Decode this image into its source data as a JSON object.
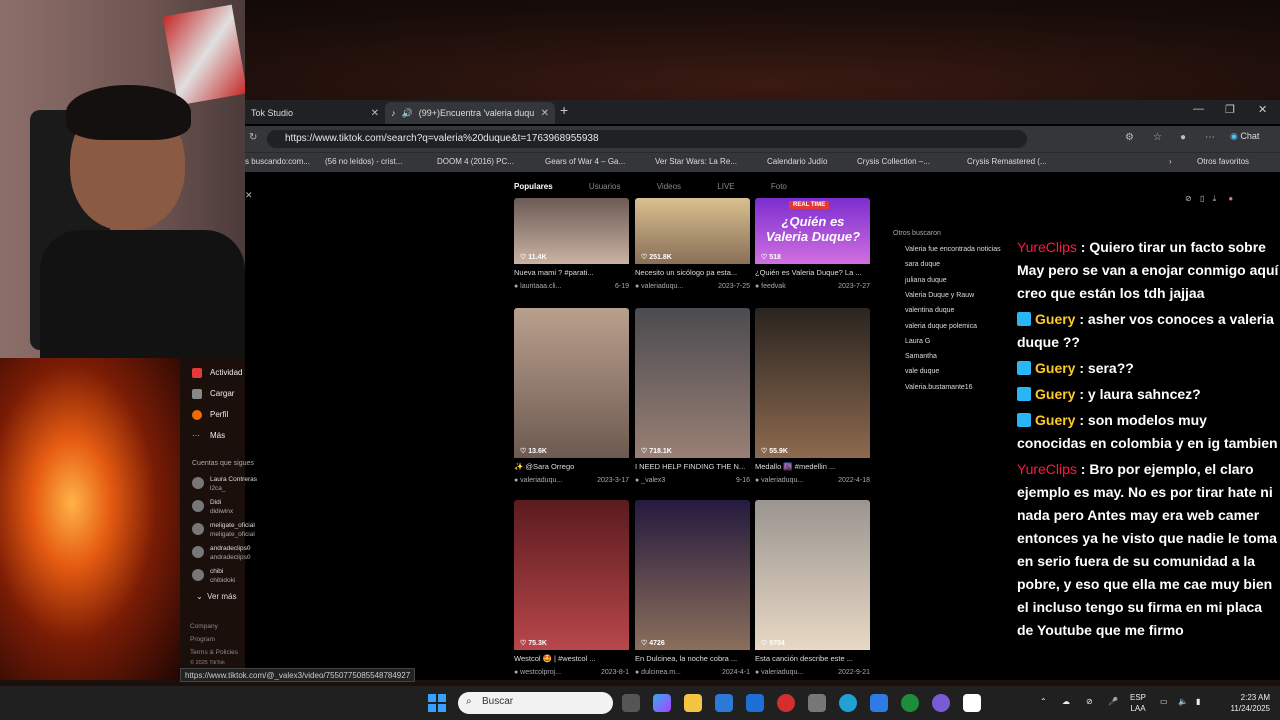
{
  "browser": {
    "tabs": [
      {
        "label": "Tok Studio"
      },
      {
        "label": "(99+)Encuentra 'valeria duqu"
      }
    ],
    "url": "https://www.tiktok.com/search?q=valeria%20duque&t=1763968955938",
    "chat_label": "Chat",
    "bookmarks": [
      "s buscando:com...",
      "(56 no leídos) - crist...",
      "DOOM 4 (2016) PC...",
      "Gears of War 4 – Ga...",
      "Ver Star Wars: La Re...",
      "Calendario Judío",
      "Crysis Collection –...",
      "Crysis Remastered (..."
    ],
    "other_favorites": "Otros favoritos",
    "status_url": "https://www.tiktok.com/@_valex3/video/7550775085548784927"
  },
  "tiktok": {
    "filters": [
      "Populares",
      "Usuarios",
      "Videos",
      "LIVE",
      "Foto"
    ],
    "nav": [
      "Actividad",
      "Cargar",
      "Perfil",
      "Más"
    ],
    "following_title": "Cuentas que sigues",
    "following": [
      {
        "name": "Laura Contreras",
        "handle": "l2ca_"
      },
      {
        "name": "Didi",
        "handle": "didiwinx"
      },
      {
        "name": "meligate_oficial",
        "handle": "meligate_oficial"
      },
      {
        "name": "andradeclips0",
        "handle": "andradeclips0"
      },
      {
        "name": "chibi",
        "handle": "chibidoki"
      }
    ],
    "see_more": "Ver más",
    "footer": [
      "Company",
      "Program",
      "Terms & Policies",
      "© 2025 TikTok"
    ],
    "others_title": "Otros buscaron",
    "others": [
      "Valeria fue encontrada noticias",
      "sara duque",
      "juliana duque",
      "Valeria Duque y Rauw",
      "valentina duque",
      "valeria duque polemica",
      "Laura G",
      "Samantha",
      "vale duque",
      "Valeria.bustamante16"
    ],
    "videos": [
      {
        "likes": "11.4K",
        "caption": "Nueva mami ? #parati...",
        "author": "lauritaaa.cli...",
        "date": "6-19",
        "colors": [
          "#6b5a55",
          "#cbb3a3"
        ]
      },
      {
        "likes": "251.8K",
        "caption": "Necesito un sicólogo pa esta...",
        "author": "valeriaduqu...",
        "date": "2023-7-25",
        "colors": [
          "#d8c08f",
          "#8a6f58"
        ]
      },
      {
        "likes": "518",
        "caption": "¿Quién es Valeria Duque? La ...",
        "author": "feedvak",
        "date": "2023-7-27",
        "colors": [
          "#7b2ecf",
          "#d16fe0"
        ],
        "overlay": "¿Quién es Valeria Duque?",
        "tag": "REAL TIME"
      },
      {
        "likes": "13.6K",
        "caption": "✨ @Sara Orrego",
        "author": "valeriaduqu...",
        "date": "2023-3-17",
        "colors": [
          "#b9a08e",
          "#6d5a50"
        ]
      },
      {
        "likes": "718.1K",
        "caption": "I NEED HELP FINDING THE N...",
        "author": "_valex3",
        "date": "9-16",
        "colors": [
          "#4b4b4f",
          "#9a7f75"
        ]
      },
      {
        "likes": "55.9K",
        "caption": "Medallo 🌆 #medellin ...",
        "author": "valeriaduqu...",
        "date": "2022-4-18",
        "colors": [
          "#2a2420",
          "#8d6a4f"
        ]
      },
      {
        "likes": "75.3K",
        "caption": "Westcol 🤩 | #westcol ...",
        "author": "westcolproj...",
        "date": "2023-8-1",
        "colors": [
          "#5b1b1e",
          "#b8474b"
        ]
      },
      {
        "likes": "4726",
        "caption": "En Dulcinea, la noche cobra ...",
        "author": "dulcinea.m...",
        "date": "2024-4-1",
        "colors": [
          "#251a3f",
          "#8b6f5b"
        ]
      },
      {
        "likes": "9704",
        "caption": "Esta canción describe este ...",
        "author": "valeriaduqu...",
        "date": "2022-9-21",
        "colors": [
          "#9a9590",
          "#e8d8c5"
        ]
      }
    ]
  },
  "chat": [
    {
      "user": "YureClips",
      "color": "red",
      "text": ": Quiero tirar un facto sobre May pero se van a enojar conmigo aquí creo que están los tdh jajjaa"
    },
    {
      "user": "Guery",
      "color": "yellow",
      "text": ": asher vos conoces a valeria duque ??"
    },
    {
      "user": "Guery",
      "color": "yellow",
      "text": ": sera??"
    },
    {
      "user": "Guery",
      "color": "yellow",
      "text": ": y laura sahncez?"
    },
    {
      "user": "Guery",
      "color": "yellow",
      "text": ": son modelos muy conocidas en colombia y en ig tambien"
    },
    {
      "user": "YureClips",
      "color": "red",
      "text": ": Bro por ejemplo, el claro ejemplo es may. No es por tirar hate ni nada pero Antes may era web camer entonces ya he visto que nadie le toma en serio fuera de su comunidad a la pobre, y eso que ella me cae muy bien el incluso tengo su firma en mi placa de Youtube que me firmo"
    }
  ],
  "taskbar": {
    "search_placeholder": "Buscar",
    "lang": "ESP",
    "lang2": "LAA",
    "time": "2:23 AM",
    "date": "11/24/2025"
  }
}
